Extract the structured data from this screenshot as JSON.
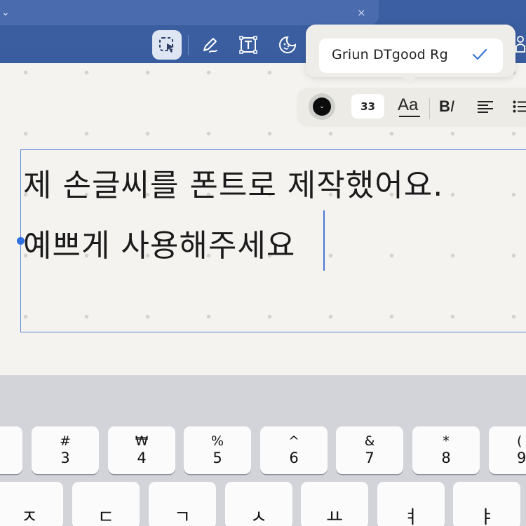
{
  "toolbar": {
    "tab_chevron": "⌄",
    "tab_close": "×",
    "tools": [
      {
        "icon": "lasso-select-icon",
        "active": true
      },
      {
        "icon": "pen-icon",
        "active": false
      },
      {
        "icon": "text-box-icon",
        "active": false
      },
      {
        "icon": "sticker-icon",
        "active": false
      }
    ]
  },
  "font_popover": {
    "selected_font": "Griun DTgood Rg",
    "check_icon": "checkmark-icon"
  },
  "format_bar": {
    "color": "#0c0c0c",
    "color_chevron": "⌄",
    "font_size": "33",
    "font_button": "Aa",
    "bold_label": "B",
    "italic_label": "I",
    "align_icon": "align-left-icon",
    "list_icon": "bullet-list-icon"
  },
  "text_box": {
    "line1": "제 손글씨를 폰트로 제작했어요.",
    "line2": "예쁘게 사용해주세요"
  },
  "keyboard": {
    "number_row": [
      {
        "top": "",
        "bottom": ""
      },
      {
        "top": "#",
        "bottom": "3"
      },
      {
        "top": "₩",
        "bottom": "4"
      },
      {
        "top": "%",
        "bottom": "5"
      },
      {
        "top": "^",
        "bottom": "6"
      },
      {
        "top": "&",
        "bottom": "7"
      },
      {
        "top": "*",
        "bottom": "8"
      },
      {
        "top": "(",
        "bottom": "9"
      }
    ],
    "letter_row": [
      "ㅈ",
      "ㄷ",
      "ㄱ",
      "ㅅ",
      "ㅛ",
      "ㅕ",
      "ㅑ"
    ]
  }
}
